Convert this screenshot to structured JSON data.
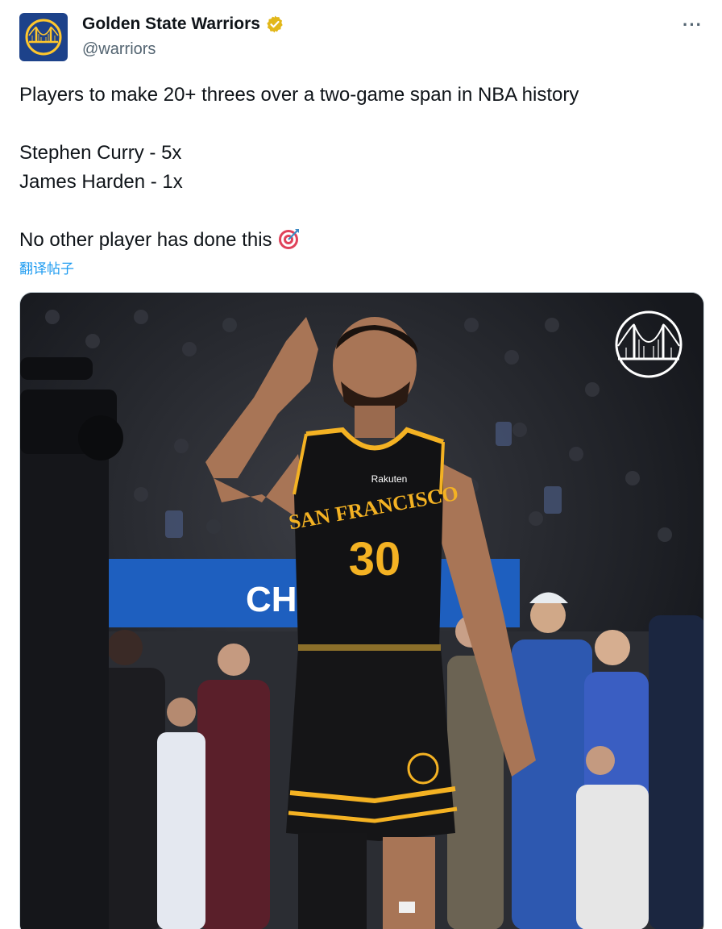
{
  "account": {
    "display_name": "Golden State Warriors",
    "handle": "@warriors",
    "verified_icon": "verified-badge-gold",
    "brand_color": "#1d428a",
    "accent_color": "#ffc72c"
  },
  "menu": {
    "more_label": "···"
  },
  "tweet": {
    "lines": [
      "Players to make 20+ threes over a two-game span in NBA history",
      "",
      "Stephen Curry - 5x",
      "James Harden - 1x",
      "",
      "No other player has done this"
    ],
    "emoji": "target-icon"
  },
  "translate_label": "翻译帖子",
  "photo": {
    "jersey_text": "SAN FRANCISCO",
    "jersey_number": "30",
    "jersey_sponsor": "Rakuten",
    "banner_text": "CH"
  }
}
